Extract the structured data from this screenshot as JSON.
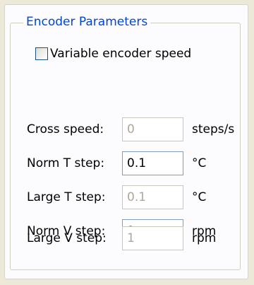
{
  "group": {
    "title": "Encoder Parameters"
  },
  "variable_encoder": {
    "label": "Variable encoder speed",
    "checked": false
  },
  "rows": [
    {
      "label": "Cross speed:",
      "value": "0",
      "unit": "steps/s",
      "enabled": false
    },
    {
      "label": "Norm T step:",
      "value": "0.1",
      "unit": "°C",
      "enabled": true
    },
    {
      "label": "Large T step:",
      "value": "0.1",
      "unit": "°C",
      "enabled": false
    },
    {
      "label": "Norm V step:",
      "value": "1",
      "unit": "rpm",
      "enabled": true
    },
    {
      "label": "Large V step:",
      "value": "1",
      "unit": "rpm",
      "enabled": false
    }
  ]
}
